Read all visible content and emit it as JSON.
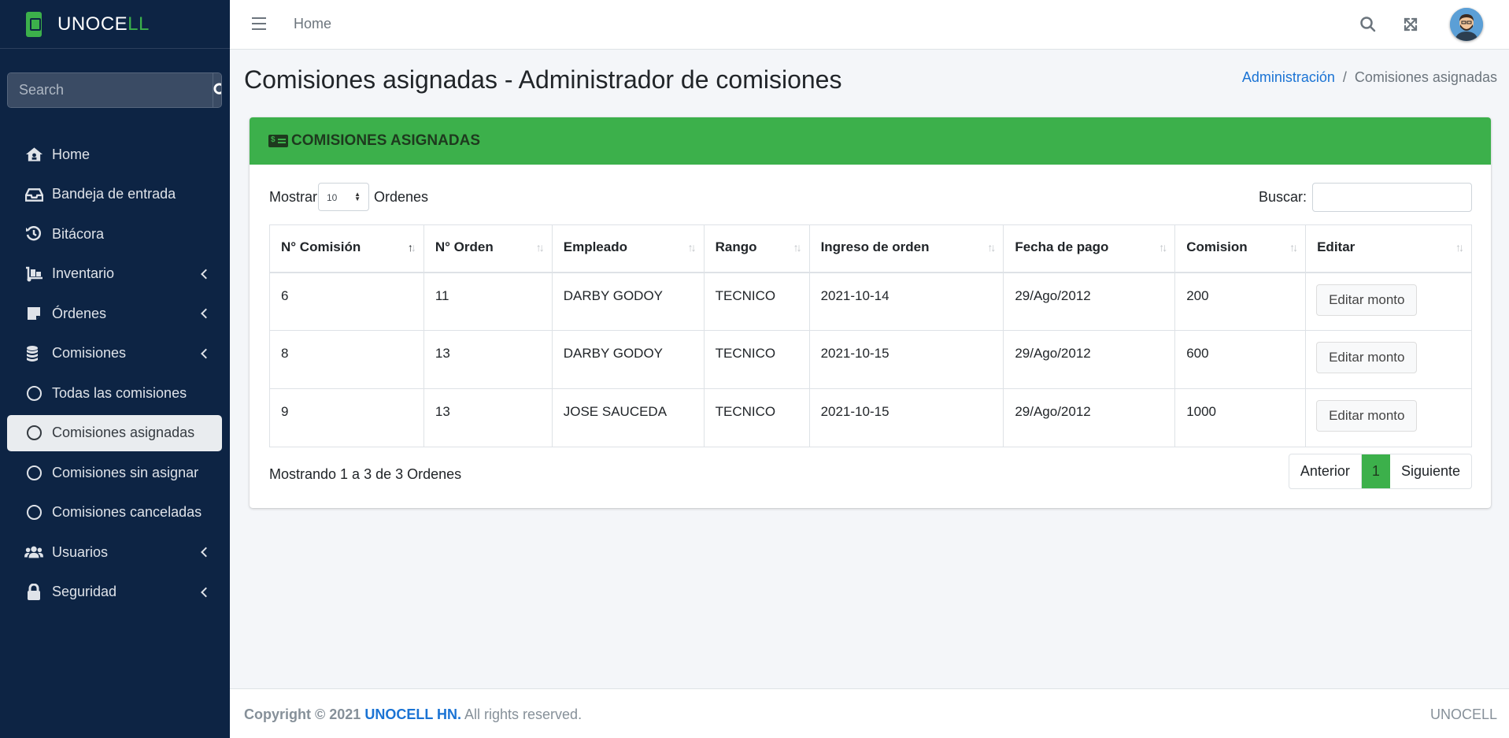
{
  "brand": {
    "name_main": "UNOCE",
    "name_accent": "LL"
  },
  "sidebar": {
    "search_placeholder": "Search",
    "items": [
      {
        "label": "Home",
        "icon": "home-icon",
        "has_arrow": false
      },
      {
        "label": "Bandeja de entrada",
        "icon": "inbox-icon",
        "has_arrow": false
      },
      {
        "label": "Bitácora",
        "icon": "history-icon",
        "has_arrow": false
      },
      {
        "label": "Inventario",
        "icon": "dolly-icon",
        "has_arrow": true
      },
      {
        "label": "Órdenes",
        "icon": "note-icon",
        "has_arrow": true
      },
      {
        "label": "Comisiones",
        "icon": "coins-icon",
        "has_arrow": true
      },
      {
        "label": "Todas las comisiones",
        "icon": "circle-icon",
        "has_arrow": false
      },
      {
        "label": "Comisiones asignadas",
        "icon": "circle-icon",
        "has_arrow": false,
        "active": true
      },
      {
        "label": "Comisiones sin asignar",
        "icon": "circle-icon",
        "has_arrow": false
      },
      {
        "label": "Comisiones canceladas",
        "icon": "circle-icon",
        "has_arrow": false
      },
      {
        "label": "Usuarios",
        "icon": "users-icon",
        "has_arrow": true
      },
      {
        "label": "Seguridad",
        "icon": "lock-icon",
        "has_arrow": true
      }
    ]
  },
  "topbar": {
    "home_label": "Home"
  },
  "page": {
    "title": "Comisiones asignadas - Administrador de comisiones",
    "breadcrumb": {
      "parent": "Administración",
      "current": "Comisiones asignadas"
    }
  },
  "card": {
    "title": "COMISIONES ASIGNADAS",
    "show_label": "Mostrar",
    "page_size": "10",
    "orders_label": "Ordenes",
    "search_label": "Buscar:",
    "columns": [
      "N° Comisión",
      "N° Orden",
      "Empleado",
      "Rango",
      "Ingreso de orden",
      "Fecha de pago",
      "Comision",
      "Editar"
    ],
    "rows": [
      {
        "comision": "6",
        "orden": "11",
        "empleado": "DARBY GODOY",
        "rango": "TECNICO",
        "ingreso": "2021-10-14",
        "fecha_pago": "29/Ago/2012",
        "monto": "200",
        "accion": "Editar monto"
      },
      {
        "comision": "8",
        "orden": "13",
        "empleado": "DARBY GODOY",
        "rango": "TECNICO",
        "ingreso": "2021-10-15",
        "fecha_pago": "29/Ago/2012",
        "monto": "600",
        "accion": "Editar monto"
      },
      {
        "comision": "9",
        "orden": "13",
        "empleado": "JOSE SAUCEDA",
        "rango": "TECNICO",
        "ingreso": "2021-10-15",
        "fecha_pago": "29/Ago/2012",
        "monto": "1000",
        "accion": "Editar monto"
      }
    ],
    "info": "Mostrando 1 a 3 de 3 Ordenes",
    "pager": {
      "prev": "Anterior",
      "current": "1",
      "next": "Siguiente"
    }
  },
  "footer": {
    "copyright": "Copyright © 2021",
    "brand": "UNOCELL HN.",
    "rights": "All rights reserved.",
    "right": "UNOCELL"
  },
  "colors": {
    "sidebar": "#0d2444",
    "accent": "#3cb04b",
    "link": "#1a73d4"
  }
}
